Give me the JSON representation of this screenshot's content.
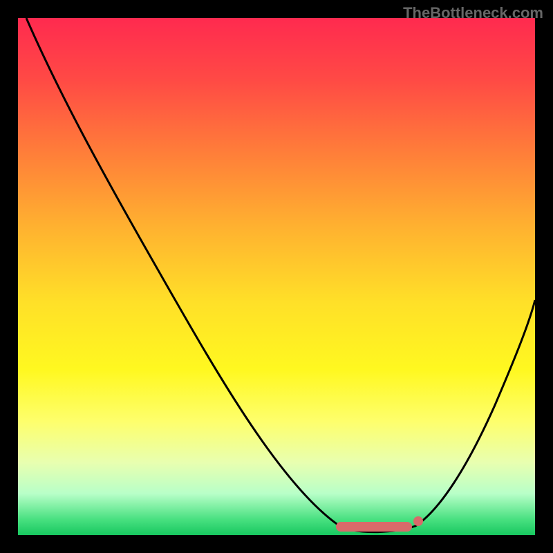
{
  "watermark": "TheBottleneck.com",
  "chart_data": {
    "type": "line",
    "title": "",
    "xlabel": "",
    "ylabel": "",
    "xlim": [
      0,
      100
    ],
    "ylim": [
      0,
      100
    ],
    "series": [
      {
        "name": "bottleneck-curve",
        "x": [
          2,
          10,
          20,
          30,
          40,
          50,
          60,
          65,
          68,
          72,
          76,
          80,
          85,
          90,
          95,
          100
        ],
        "y": [
          100,
          87,
          70,
          54,
          38,
          22,
          6,
          1,
          0,
          0,
          0,
          3,
          12,
          25,
          40,
          57
        ]
      }
    ],
    "optimal_range": {
      "start": 64,
      "end": 78
    },
    "marker_point": {
      "x": 78,
      "y": 2
    },
    "background_gradient": {
      "top": "#ff2a4f",
      "mid": "#ffe028",
      "bottom": "#18c860"
    },
    "curve_color": "#000000",
    "marker_color": "#d86a6a"
  }
}
